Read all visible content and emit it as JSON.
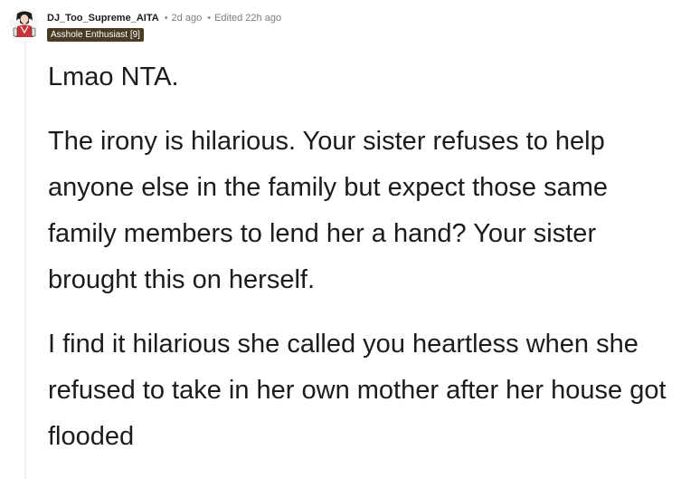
{
  "comment": {
    "author": "DJ_Too_Supreme_AITA",
    "separator": "•",
    "posted": "2d ago",
    "edited": "Edited 22h ago",
    "flair": "Asshole Enthusiast [9]",
    "avatar_icon": "user-avatar-icon",
    "paragraphs": [
      "Lmao NTA.",
      "The irony is hilarious. Your sister refuses to help anyone else in the family but expect those same family members to lend her a hand? Your sister brought this on herself.",
      "I find it hilarious she called you heartless when she refused to take in her own mother after her house got flooded"
    ]
  },
  "colors": {
    "flair_bg": "#4a3b24",
    "thread_line": "#edeff1",
    "text": "#1c1c1c",
    "meta": "#7c7c7c"
  }
}
